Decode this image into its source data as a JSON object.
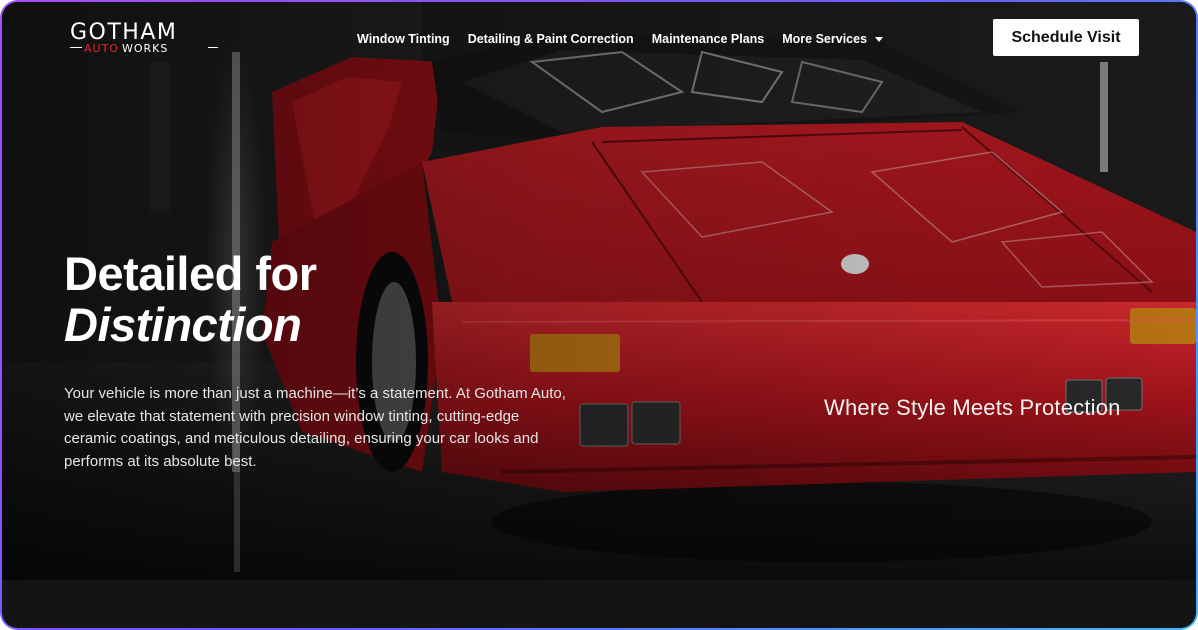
{
  "brand": {
    "logo_main": "GOTHAM",
    "logo_sub_red": "AUTO",
    "logo_sub_white": "WORKS"
  },
  "nav": {
    "items": [
      {
        "label": "Window Tinting"
      },
      {
        "label": "Detailing & Paint Correction"
      },
      {
        "label": "Maintenance Plans"
      },
      {
        "label": "More Services"
      }
    ],
    "cta_label": "Schedule Visit"
  },
  "hero": {
    "headline_line1": "Detailed for",
    "headline_line2": "Distinction",
    "lead": "Your vehicle is more than just a machine—it’s a statement. At Gotham Auto, we elevate that statement with precision window tinting, cutting-edge ceramic coatings, and meticulous detailing, ensuring your car looks and performs at its absolute best.",
    "tagline": "Where Style Meets Protection"
  },
  "colors": {
    "accent_red": "#e0262a",
    "car_red": "#b3121b",
    "frame_gradient_start": "#a64dff",
    "frame_gradient_end": "#3fb6ff"
  },
  "icons": {
    "dropdown": "chevron-down-icon"
  }
}
